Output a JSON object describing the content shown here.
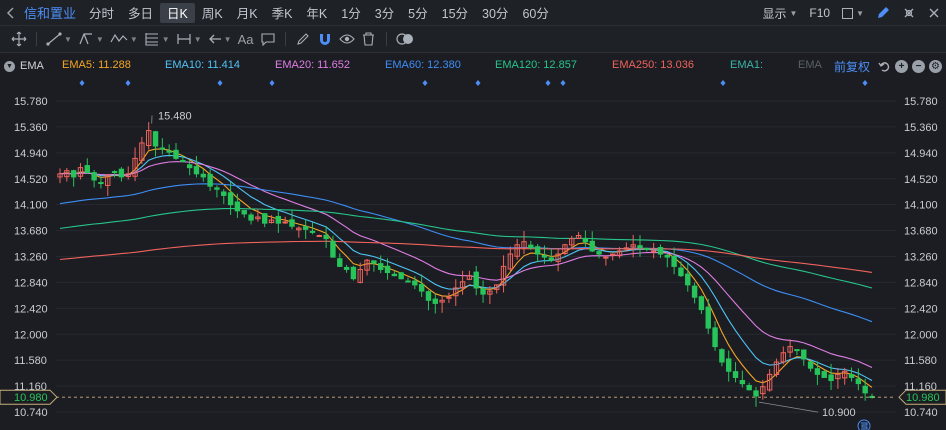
{
  "topbar": {
    "stock_name": "信和置业",
    "periods": [
      "分时",
      "多日",
      "日K",
      "周K",
      "月K",
      "季K",
      "年K",
      "1分",
      "3分",
      "5分",
      "15分",
      "30分",
      "60分"
    ],
    "active_period": "日K",
    "display_label": "显示",
    "f10_label": "F10"
  },
  "drawing_tools": {
    "text_tool_label": "Aa"
  },
  "ema_legend": {
    "title": "EMA",
    "items": [
      {
        "label": "EMA5: 11.288",
        "color": "#f5a623"
      },
      {
        "label": "EMA10: 11.414",
        "color": "#4fc3f7"
      },
      {
        "label": "EMA20: 11.652",
        "color": "#e07ee6"
      },
      {
        "label": "EMA60: 12.380",
        "color": "#3d8ef5"
      },
      {
        "label": "EMA120: 12.857",
        "color": "#27c48a"
      },
      {
        "label": "EMA250: 13.036",
        "color": "#f0625c"
      },
      {
        "label": "EMA1:",
        "color": "#3bb3a8"
      },
      {
        "label": "EMA",
        "color": "#5a6068"
      }
    ],
    "restore_label": "前复权"
  },
  "chart_data": {
    "type": "candlestick",
    "y_ticks": [
      "15.780",
      "15.360",
      "14.940",
      "14.520",
      "14.100",
      "13.680",
      "13.260",
      "12.840",
      "12.420",
      "12.000",
      "11.580",
      "11.160",
      "10.740"
    ],
    "ylim": [
      10.74,
      15.78
    ],
    "current_price_label": "10.980",
    "current_price": 10.98,
    "high_annotation": "15.480",
    "low_annotation": "10.900",
    "candle_count": 120,
    "candles_close": [
      14.6,
      14.65,
      14.55,
      14.7,
      14.62,
      14.5,
      14.45,
      14.58,
      14.62,
      14.55,
      14.6,
      14.85,
      15.1,
      15.3,
      15.05,
      15.0,
      14.95,
      14.85,
      14.8,
      14.7,
      14.6,
      14.55,
      14.4,
      14.35,
      14.25,
      14.1,
      14.0,
      13.95,
      13.85,
      13.9,
      13.8,
      13.85,
      13.8,
      13.82,
      13.75,
      13.72,
      13.7,
      13.65,
      13.6,
      13.55,
      13.25,
      13.1,
      13.05,
      12.9,
      13.05,
      13.2,
      13.15,
      13.05,
      13.0,
      12.95,
      12.9,
      12.85,
      12.8,
      12.7,
      12.55,
      12.5,
      12.55,
      12.6,
      12.75,
      12.85,
      12.95,
      12.75,
      12.65,
      12.7,
      12.8,
      13.1,
      13.3,
      13.45,
      13.5,
      13.4,
      13.3,
      13.25,
      13.2,
      13.3,
      13.45,
      13.55,
      13.6,
      13.5,
      13.35,
      13.3,
      13.25,
      13.3,
      13.35,
      13.4,
      13.45,
      13.4,
      13.38,
      13.35,
      13.3,
      13.25,
      13.1,
      12.95,
      12.8,
      12.6,
      12.4,
      12.1,
      11.8,
      11.55,
      11.4,
      11.3,
      11.2,
      11.1,
      11.0,
      11.15,
      11.35,
      11.55,
      11.7,
      11.8,
      11.75,
      11.6,
      11.45,
      11.35,
      11.3,
      11.25,
      11.35,
      11.4,
      11.3,
      11.2,
      11.05,
      10.98
    ]
  }
}
